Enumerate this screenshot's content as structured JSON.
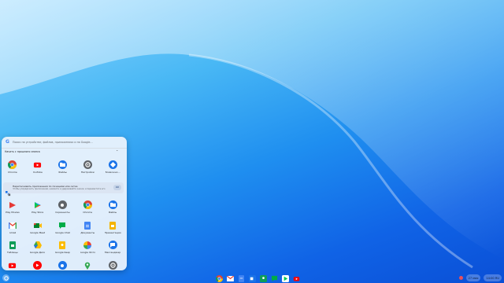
{
  "launcher": {
    "search": {
      "placeholder": "Поиск на устройстве, файлов, приложениях и на Google…"
    },
    "continue": {
      "title": "Начать с прошлого сеанса"
    },
    "recent_apps": [
      {
        "label": "Chrome",
        "icon": "chrome-icon"
      },
      {
        "label": "YouTube",
        "icon": "youtube-icon"
      },
      {
        "label": "Файлы",
        "icon": "files-icon"
      },
      {
        "label": "Настройки",
        "icon": "settings-icon"
      },
      {
        "label": "Возможно…",
        "icon": "explore-icon"
      }
    ],
    "notice": {
      "title": "Перетаскивать приложения по позициям или сетке",
      "text": "Чтобы упорядочить приложения, нажмите и удерживайте значок и переместите его",
      "button": "ОК"
    },
    "apps_row1": [
      {
        "label": "Play Movies",
        "icon": "play-movies-icon"
      },
      {
        "label": "Play Store",
        "icon": "play-store-icon"
      },
      {
        "label": "Скриншоты",
        "icon": "screenshot-icon"
      },
      {
        "label": "Chrome",
        "icon": "chrome-icon"
      },
      {
        "label": "Файлы",
        "icon": "files-icon"
      }
    ],
    "apps_row2": [
      {
        "label": "Gmail",
        "icon": "gmail-icon"
      },
      {
        "label": "Google Meet",
        "icon": "meet-icon"
      },
      {
        "label": "Google Chat",
        "icon": "chat-icon"
      },
      {
        "label": "Документы",
        "icon": "docs-icon"
      },
      {
        "label": "Презентации",
        "icon": "slides-icon"
      }
    ],
    "apps_row3": [
      {
        "label": "Таблицы",
        "icon": "sheets-icon"
      },
      {
        "label": "Google Диск",
        "icon": "drive-icon"
      },
      {
        "label": "Google Keep",
        "icon": "keep-icon"
      },
      {
        "label": "Google Фото",
        "icon": "photos-icon"
      },
      {
        "label": "Мессенджер",
        "icon": "messages-icon"
      }
    ],
    "apps_row4": [
      {
        "label": "",
        "icon": "youtube-icon"
      },
      {
        "label": "",
        "icon": "youtube-music-icon"
      },
      {
        "label": "",
        "icon": "camera-icon"
      },
      {
        "label": "",
        "icon": "maps-icon"
      },
      {
        "label": "",
        "icon": "settings-icon"
      }
    ]
  },
  "shelf": {
    "pinned": [
      "chrome-icon",
      "gmail-icon",
      "docs-icon",
      "meet-icon",
      "classroom-icon",
      "chat-icon",
      "play-store-icon",
      "youtube-icon"
    ],
    "tray": {
      "date": "27 мая",
      "time": "14:00 RU"
    }
  },
  "colors": {
    "accent": "#1a73e8",
    "wallpaper_top": "#8fd6ff",
    "wallpaper_bottom": "#0a4fd6"
  }
}
